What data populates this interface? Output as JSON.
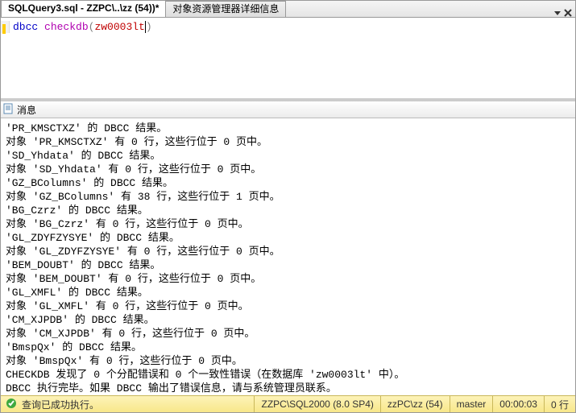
{
  "tabs": {
    "active": "SQLQuery3.sql - ZZPC\\..\\zz (54))*",
    "other": "对象资源管理器详细信息"
  },
  "editor": {
    "code_kw1": "dbcc",
    "code_kw2": "checkdb",
    "code_paren_open": "(",
    "code_arg": "zw0003lt",
    "code_paren_close": ")"
  },
  "messages_tab": "消息",
  "result_lines": [
    "'PR_KMSCTXZ' 的 DBCC 结果。",
    "对象 'PR_KMSCTXZ' 有 0 行，这些行位于 0 页中。",
    "'SD_Yhdata' 的 DBCC 结果。",
    "对象 'SD_Yhdata' 有 0 行，这些行位于 0 页中。",
    "'GZ_BColumns' 的 DBCC 结果。",
    "对象 'GZ_BColumns' 有 38 行，这些行位于 1 页中。",
    "'BG_Czrz' 的 DBCC 结果。",
    "对象 'BG_Czrz' 有 0 行，这些行位于 0 页中。",
    "'GL_ZDYFZYSYE' 的 DBCC 结果。",
    "对象 'GL_ZDYFZYSYE' 有 0 行，这些行位于 0 页中。",
    "'BEM_DOUBT' 的 DBCC 结果。",
    "对象 'BEM_DOUBT' 有 0 行，这些行位于 0 页中。",
    "'GL_XMFL' 的 DBCC 结果。",
    "对象 'GL_XMFL' 有 0 行，这些行位于 0 页中。",
    "'CM_XJPDB' 的 DBCC 结果。",
    "对象 'CM_XJPDB' 有 0 行，这些行位于 0 页中。",
    "'BmspQx' 的 DBCC 结果。",
    "对象 'BmspQx' 有 0 行，这些行位于 0 页中。",
    "CHECKDB 发现了 0 个分配错误和 0 个一致性错误（在数据库 'zw0003lt' 中）。",
    "DBCC 执行完毕。如果 DBCC 输出了错误信息，请与系统管理员联系。"
  ],
  "status": {
    "message": "查询已成功执行。",
    "server": "ZZPC\\SQL2000 (8.0 SP4)",
    "login": "zzPC\\zz (54)",
    "db": "master",
    "elapsed": "00:00:03",
    "rows": "0 行"
  }
}
